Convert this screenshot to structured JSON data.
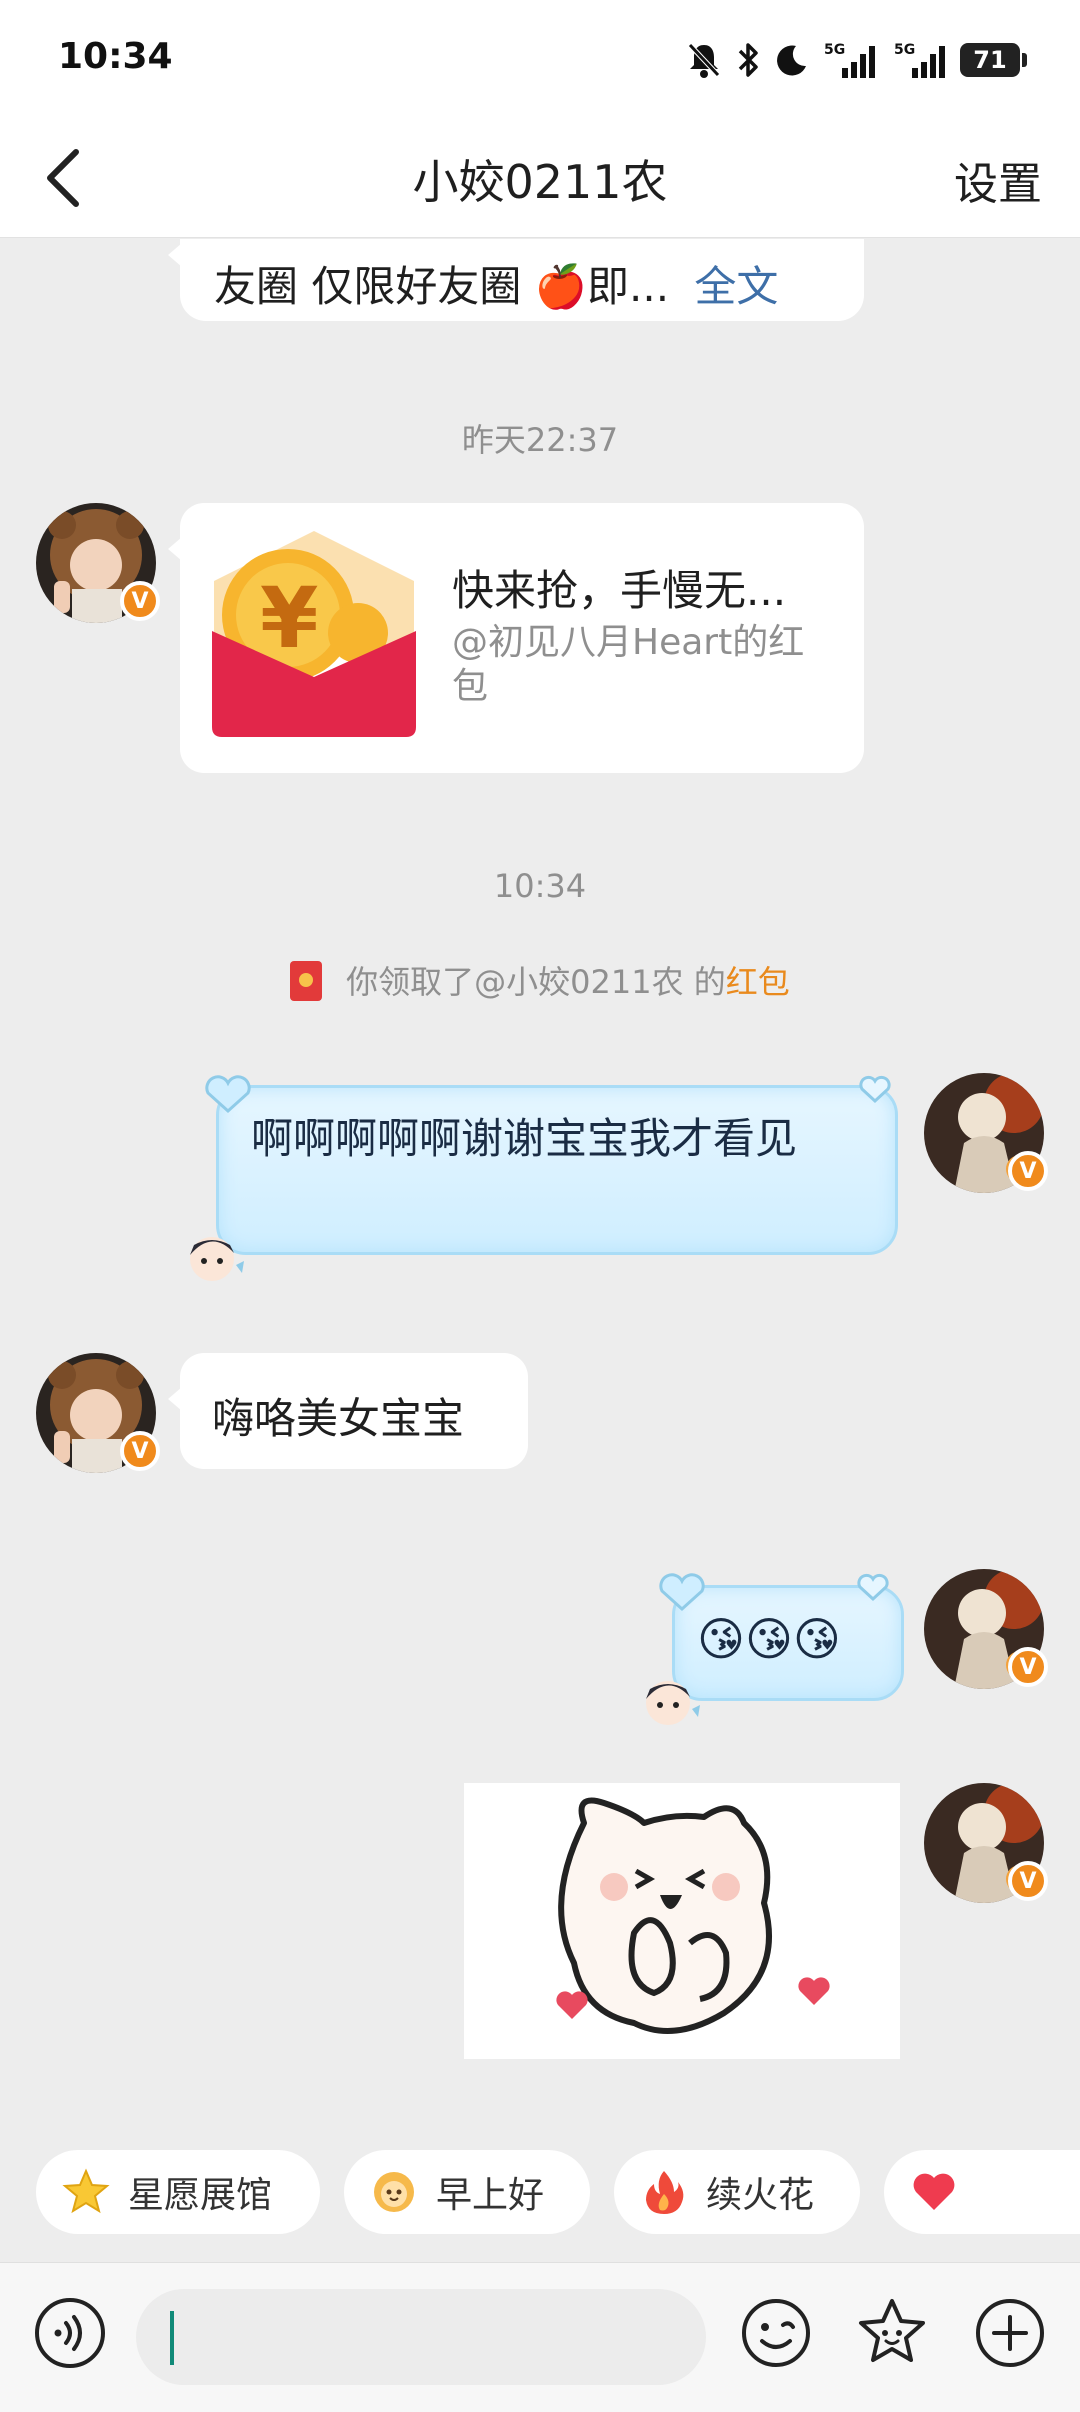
{
  "status_bar": {
    "time": "10:34",
    "signal1": "5G",
    "signal2": "5G",
    "battery": "71"
  },
  "header": {
    "title": "小姣0211农",
    "settings": "设置"
  },
  "messages": {
    "truncated_post": "友圈 仅限好友圈 🍎即...",
    "read_more": "全文",
    "time1": "昨天22:37",
    "red_packet_title": "快来抢，手慢无...",
    "red_packet_sub": "@初见八月Heart的红包",
    "time2": "10:34",
    "notice_prefix": "你领取了@小姣0211农 的",
    "notice_link": "红包",
    "my_msg1": "啊啊啊啊啊谢谢宝宝我才看见",
    "their_msg": "嗨咯美女宝宝",
    "my_emoji": "😘😘😘",
    "v_badge": "V"
  },
  "chips": [
    {
      "label": "星愿展馆",
      "icon": "star-icon"
    },
    {
      "label": "早上好",
      "icon": "sun-face-icon"
    },
    {
      "label": "续火花",
      "icon": "fire-icon"
    },
    {
      "label": "",
      "icon": "heart-icon"
    }
  ],
  "colors": {
    "accent_orange": "#e98a1d",
    "bubble_blue": "#cfeeff",
    "read_more_blue": "#3e6fa8",
    "background": "#ededed"
  }
}
